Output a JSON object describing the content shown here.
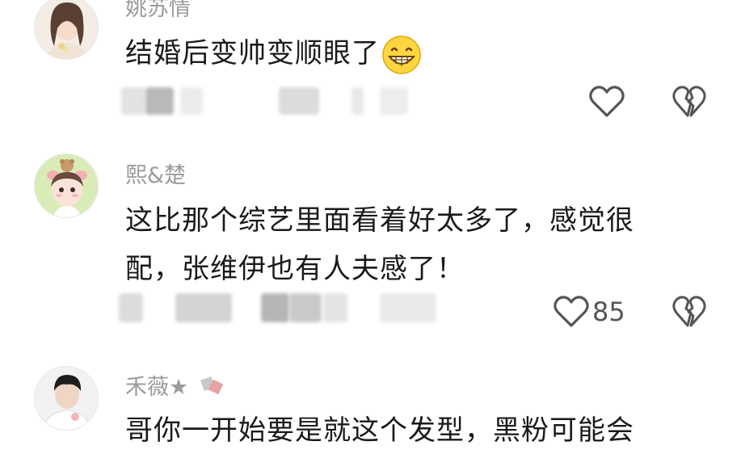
{
  "comments": [
    {
      "username": "姚苏情",
      "content": "结婚后变帅变顺眼了",
      "emoji_icon": "grinning-face-emoji",
      "like_count": ""
    },
    {
      "username": "熙&楚",
      "content_line1": "这比那个综艺里面看着好太多了，感觉很",
      "content_line2": "配，张维伊也有人夫感了！",
      "like_count": "85"
    },
    {
      "username": "禾薇★",
      "content": "哥你一开始要是就这个发型，黑粉可能会"
    }
  ],
  "icons": {
    "like": "heart-outline-icon",
    "dislike": "broken-heart-icon"
  },
  "colors": {
    "text": "#1a1a1a",
    "username": "#9b9b9b",
    "icon": "#555555",
    "background": "#ffffff"
  }
}
